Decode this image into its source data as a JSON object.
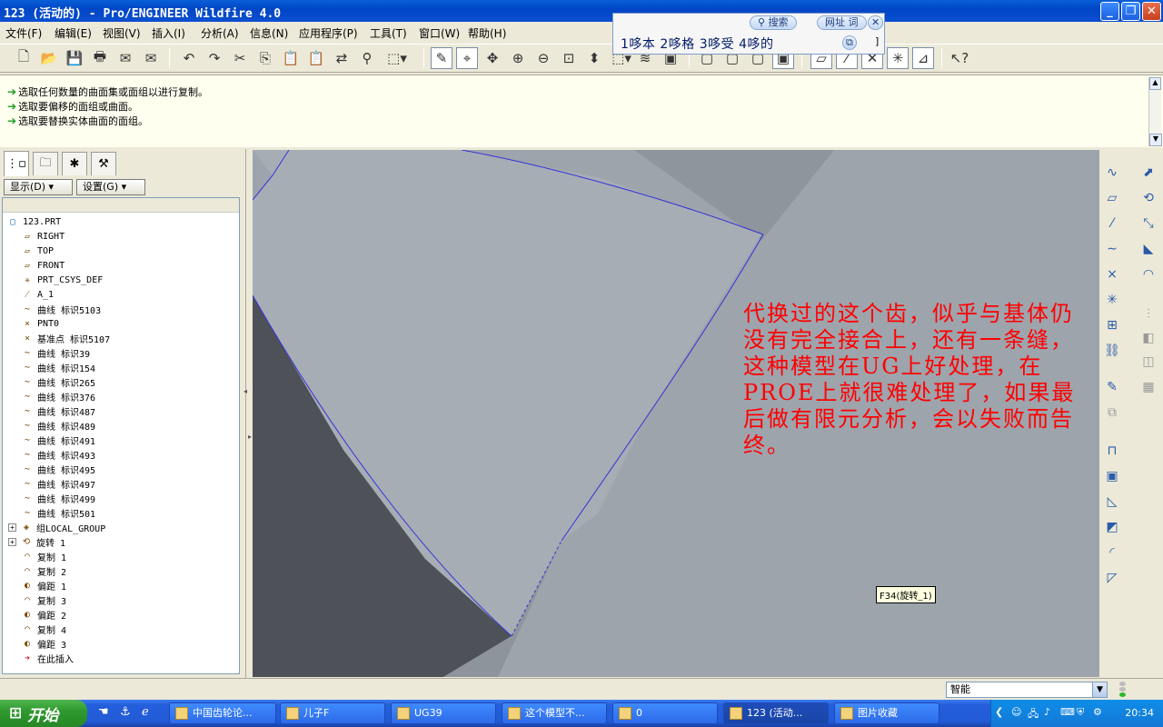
{
  "window": {
    "title": "123 (活动的) - Pro/ENGINEER Wildfire 4.0",
    "minimize": "_",
    "restore": "❐",
    "close": "✕"
  },
  "menu": [
    "文件(F)",
    "编辑(E)",
    "视图(V)",
    "插入(I)",
    "分析(A)",
    "信息(N)",
    "应用程序(P)",
    "工具(T)",
    "窗口(W)",
    "帮助(H)"
  ],
  "ime": {
    "search": "搜索",
    "url": "网址",
    "word": "词",
    "candidates": "1哆本  2哆格  3哆受  4哆的"
  },
  "messages": [
    "选取任何数量的曲面集或面组以进行复制。",
    "选取要偏移的面组或曲面。",
    "选取要替换实体曲面的面组。"
  ],
  "panel": {
    "show_label": "显示(D) ▾",
    "settings_label": "设置(G) ▾"
  },
  "tree": [
    {
      "icon": "part",
      "label": "123.PRT",
      "level": 0
    },
    {
      "icon": "datum-plane",
      "label": "RIGHT",
      "level": 1
    },
    {
      "icon": "datum-plane",
      "label": "TOP",
      "level": 1
    },
    {
      "icon": "datum-plane",
      "label": "FRONT",
      "level": 1
    },
    {
      "icon": "csys",
      "label": "PRT_CSYS_DEF",
      "level": 1
    },
    {
      "icon": "axis",
      "label": "A_1",
      "level": 1
    },
    {
      "icon": "curve",
      "label": "曲线 标识5103",
      "level": 1
    },
    {
      "icon": "point",
      "label": "PNT0",
      "level": 1
    },
    {
      "icon": "point",
      "label": "基准点 标识5107",
      "level": 1
    },
    {
      "icon": "curve",
      "label": "曲线 标识39",
      "level": 1
    },
    {
      "icon": "curve",
      "label": "曲线 标识154",
      "level": 1
    },
    {
      "icon": "curve",
      "label": "曲线 标识265",
      "level": 1
    },
    {
      "icon": "curve",
      "label": "曲线 标识376",
      "level": 1
    },
    {
      "icon": "curve",
      "label": "曲线 标识487",
      "level": 1
    },
    {
      "icon": "curve",
      "label": "曲线 标识489",
      "level": 1
    },
    {
      "icon": "curve",
      "label": "曲线 标识491",
      "level": 1
    },
    {
      "icon": "curve",
      "label": "曲线 标识493",
      "level": 1
    },
    {
      "icon": "curve",
      "label": "曲线 标识495",
      "level": 1
    },
    {
      "icon": "curve",
      "label": "曲线 标识497",
      "level": 1
    },
    {
      "icon": "curve",
      "label": "曲线 标识499",
      "level": 1
    },
    {
      "icon": "curve",
      "label": "曲线 标识501",
      "level": 1
    },
    {
      "icon": "group",
      "label": "组LOCAL_GROUP",
      "level": 1,
      "expander": "+"
    },
    {
      "icon": "revolve",
      "label": "旋转 1",
      "level": 1,
      "expander": "+"
    },
    {
      "icon": "copy",
      "label": "复制 1",
      "level": 1
    },
    {
      "icon": "copy",
      "label": "复制 2",
      "level": 1
    },
    {
      "icon": "offset",
      "label": "偏距 1",
      "level": 1
    },
    {
      "icon": "copy",
      "label": "复制 3",
      "level": 1
    },
    {
      "icon": "offset",
      "label": "偏距 2",
      "level": 1
    },
    {
      "icon": "copy",
      "label": "复制 4",
      "level": 1
    },
    {
      "icon": "offset",
      "label": "偏距 3",
      "level": 1
    },
    {
      "icon": "insert-here",
      "label": "在此插入",
      "level": 1
    }
  ],
  "viewport": {
    "annotation": "代换过的这个齿，似乎与基体仍没有完全接合上，还有一条缝，这种模型在UG上好处理，在PROE上就很难处理了，如果最后做有限元分析，会以失败而告终。",
    "feature_label": "F34(旋转_1)",
    "colors": {
      "surface": "#9ea4ac",
      "light": "#a5acb4",
      "dark": "#4e5258",
      "edge": "#3232d8"
    }
  },
  "status": {
    "filter": "智能"
  },
  "taskbar": {
    "start": "开始",
    "tasks": [
      "中国齿轮论...",
      "儿子F",
      "UG39",
      "这个模型不...",
      "0",
      "123 (活动...",
      "图片收藏"
    ],
    "clock": "20:34"
  }
}
